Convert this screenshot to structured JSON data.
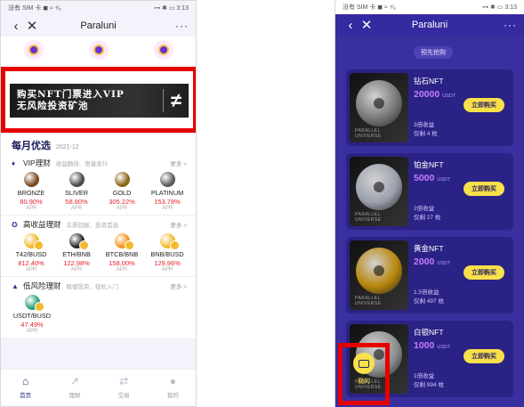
{
  "status_bar": {
    "left": "没有 SIM 卡 ◼ ≈ ⁴⁄₈",
    "right": "⊶ ✱ ▭ 3:13"
  },
  "left_screen": {
    "nav_title": "Paraluni",
    "nav_more": "···",
    "banner": {
      "line1": "购买NFT门票进入VIP",
      "line2": "无风险投资矿池",
      "logo": "≠"
    },
    "monthly": {
      "title": "每月优选",
      "date": "2021-12"
    },
    "sections": [
      {
        "title": "VIP理财",
        "subtitle": "收益翻倍、限量发行",
        "more": "更多 >",
        "items": [
          {
            "name": "BRONZE",
            "rate": "80.90%",
            "apr": "APR",
            "color": "#7a4a1e"
          },
          {
            "name": "SLIVER",
            "rate": "58.80%",
            "apr": "APR",
            "color": "#4a4a4a"
          },
          {
            "name": "GOLD",
            "rate": "305.22%",
            "apr": "APR",
            "color": "#8a6414"
          },
          {
            "name": "PLATINUM",
            "rate": "153.78%",
            "apr": "APR",
            "color": "#5a5a5a"
          }
        ]
      },
      {
        "title": "高收益理财",
        "subtitle": "丰厚回报、投资首选",
        "more": "更多 >",
        "items": [
          {
            "name": "T42/BUSD",
            "rate": "812.40%",
            "apr": "APR",
            "color": "#f3ba2f"
          },
          {
            "name": "ETH/BNB",
            "rate": "122.98%",
            "apr": "APR",
            "color": "#222222"
          },
          {
            "name": "BTCB/BNB",
            "rate": "158.00%",
            "apr": "APR",
            "color": "#f7931a"
          },
          {
            "name": "BNB/BUSD",
            "rate": "129.96%",
            "apr": "APR",
            "color": "#f3ba2f"
          }
        ]
      },
      {
        "title": "低风险理财",
        "subtitle": "稳健投资、轻松入门",
        "more": "更多 >",
        "items": [
          {
            "name": "USDT/BUSD",
            "rate": "47.49%",
            "apr": "APR",
            "color": "#26a17b"
          }
        ]
      }
    ],
    "tabs": [
      {
        "label": "首页",
        "icon": "home-icon"
      },
      {
        "label": "理财",
        "icon": "chart-icon"
      },
      {
        "label": "交易",
        "icon": "exchange-icon"
      },
      {
        "label": "我的",
        "icon": "user-icon"
      }
    ]
  },
  "right_screen": {
    "nav_title": "Paraluni",
    "nav_more": "···",
    "presale": "预先抢购",
    "cards": [
      {
        "name": "钻石NFT",
        "price": "20000",
        "unit": "USDT",
        "multiplier": "3倍收益",
        "remaining": "仅剩 4 枚",
        "button": "立即购买",
        "tint": "#777777",
        "brand1": "PARALLEL",
        "brand2": "UNIVERSE"
      },
      {
        "name": "铂金NFT",
        "price": "5000",
        "unit": "USDT",
        "multiplier": "2倍收益",
        "remaining": "仅剩 27 枚",
        "button": "立即购买",
        "tint": "#9aa0ad",
        "brand1": "PARALLEL",
        "brand2": "UNIVERSE"
      },
      {
        "name": "黄金NFT",
        "price": "2000",
        "unit": "USDT",
        "multiplier": "1.5倍收益",
        "remaining": "仅剩 497 枚",
        "button": "立即购买",
        "tint": "#b8860b",
        "brand1": "PARALLEL",
        "brand2": "UNIVERSE"
      },
      {
        "name": "白银NFT",
        "price": "1000",
        "unit": "USDT",
        "multiplier": "1倍收益",
        "remaining": "仅剩 994 枚",
        "button": "立即购买",
        "tint": "#8e8e8e",
        "brand1": "PARALLEL",
        "brand2": "UNIVERSE"
      }
    ],
    "my_button": "我的"
  }
}
